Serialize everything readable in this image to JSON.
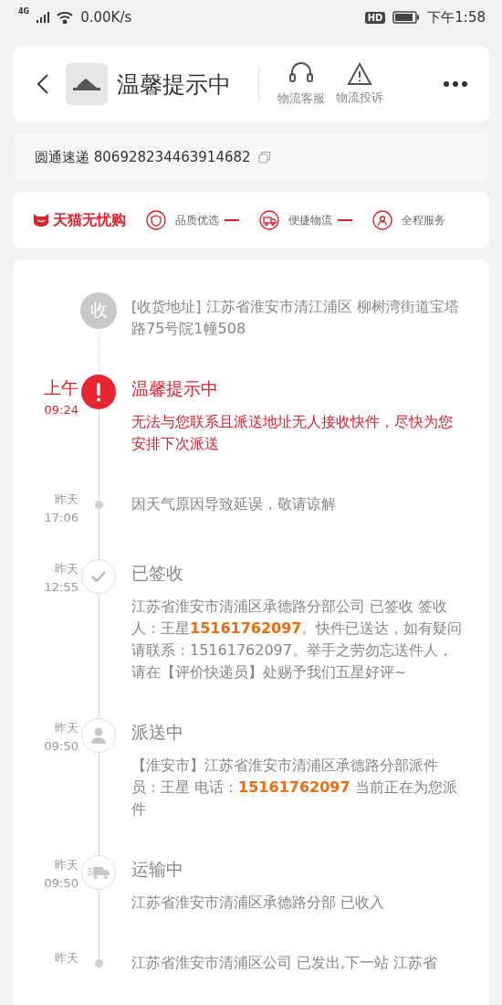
{
  "status_bar": {
    "network": "4G",
    "speed": "0.00K/s",
    "hd": "HD",
    "time": "下午1:58"
  },
  "header": {
    "title": "温馨提示中",
    "actions": [
      {
        "kind": "headset",
        "label": "物流客服"
      },
      {
        "kind": "warning",
        "label": "物流投诉"
      }
    ]
  },
  "tracking": {
    "carrier": "圆通速递",
    "number": "806928234463914682"
  },
  "service_bar": {
    "brand": "天猫无忧购",
    "items": [
      {
        "kind": "shield",
        "label": "品质优选"
      },
      {
        "kind": "truck",
        "label": "便捷物流"
      },
      {
        "kind": "person",
        "label": "全程服务"
      }
    ]
  },
  "timeline": [
    {
      "kind": "address",
      "badge": "收",
      "text": "[收货地址] 江苏省淮安市清江浦区 柳树湾街道宝塔路75号院1幢508",
      "highlighted": false
    },
    {
      "kind": "alert",
      "day": "上午",
      "time": "09:24",
      "title": "温馨提示中",
      "text": "无法与您联系且派送地址无人接收快件，尽快为您安排下次派送",
      "highlighted": true
    },
    {
      "kind": "dot",
      "day": "昨天",
      "time": "17:06",
      "text": "因天气原因导致延误，敬请谅解",
      "highlighted": false
    },
    {
      "kind": "check",
      "day": "昨天",
      "time": "12:55",
      "title": "已签收",
      "text": "江苏省淮安市清浦区承德路分部公司 已签收 签收人：王星**15161762097**。快件已送达，如有疑问请联系：15161762097。举手之劳勿忘送件人，请在【评价快递员】处赐予我们五星好评~",
      "highlighted": false
    },
    {
      "kind": "person",
      "day": "昨天",
      "time": "09:50",
      "title": "派送中",
      "text": "【淮安市】江苏省淮安市清浦区承德路分部派件员：王星 电话：**15161762097** 当前正在为您派件",
      "highlighted": false
    },
    {
      "kind": "truck",
      "day": "昨天",
      "time": "09:50",
      "title": "运输中",
      "text": "江苏省淮安市清浦区承德路分部 已收入",
      "highlighted": false
    },
    {
      "kind": "dot",
      "day": "昨天",
      "text": "江苏省淮安市清浦区公司 已发出,下一站 江苏省",
      "highlighted": false
    }
  ]
}
